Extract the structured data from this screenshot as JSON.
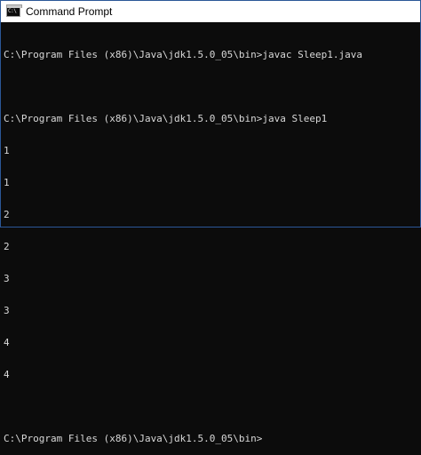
{
  "window": {
    "title": "Command Prompt",
    "icon": "cmd-icon",
    "icon_text": "C:\\",
    "colors": {
      "titlebar": "#ffffff",
      "console_bg": "#0c0c0c",
      "console_text": "#d8d8d8"
    }
  },
  "console": {
    "lines": [
      "C:\\Program Files (x86)\\Java\\jdk1.5.0_05\\bin>javac Sleep1.java",
      "",
      "C:\\Program Files (x86)\\Java\\jdk1.5.0_05\\bin>java Sleep1",
      "1",
      "1",
      "2",
      "2",
      "3",
      "3",
      "4",
      "4",
      "",
      "C:\\Program Files (x86)\\Java\\jdk1.5.0_05\\bin>"
    ]
  }
}
